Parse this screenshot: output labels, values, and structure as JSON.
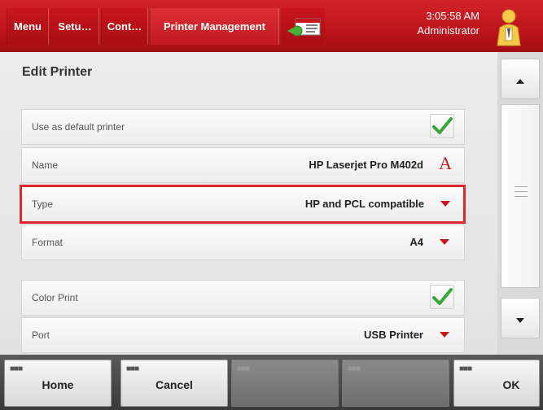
{
  "topbar": {
    "tabs": [
      {
        "label": "Menu"
      },
      {
        "label": "Setu…"
      },
      {
        "label": "Cont…"
      },
      {
        "label": "Printer Management"
      }
    ],
    "time": "3:05:58 AM",
    "user": "Administrator"
  },
  "content": {
    "title": "Edit Printer",
    "rows": [
      {
        "label": "Use as default printer",
        "checked": true
      },
      {
        "label": "Name",
        "value": "HP Laserjet Pro M402d"
      },
      {
        "label": "Type",
        "value": "HP and PCL compatible"
      },
      {
        "label": "Format",
        "value": "A4"
      },
      {
        "label": "Color Print",
        "checked": true
      },
      {
        "label": "Port",
        "value": "USB Printer"
      }
    ]
  },
  "bottombar": {
    "home": "Home",
    "cancel": "Cancel",
    "ok": "OK"
  },
  "colors": {
    "accent": "#c8161d",
    "highlight": "#e0262e",
    "check": "#3aa53a"
  }
}
